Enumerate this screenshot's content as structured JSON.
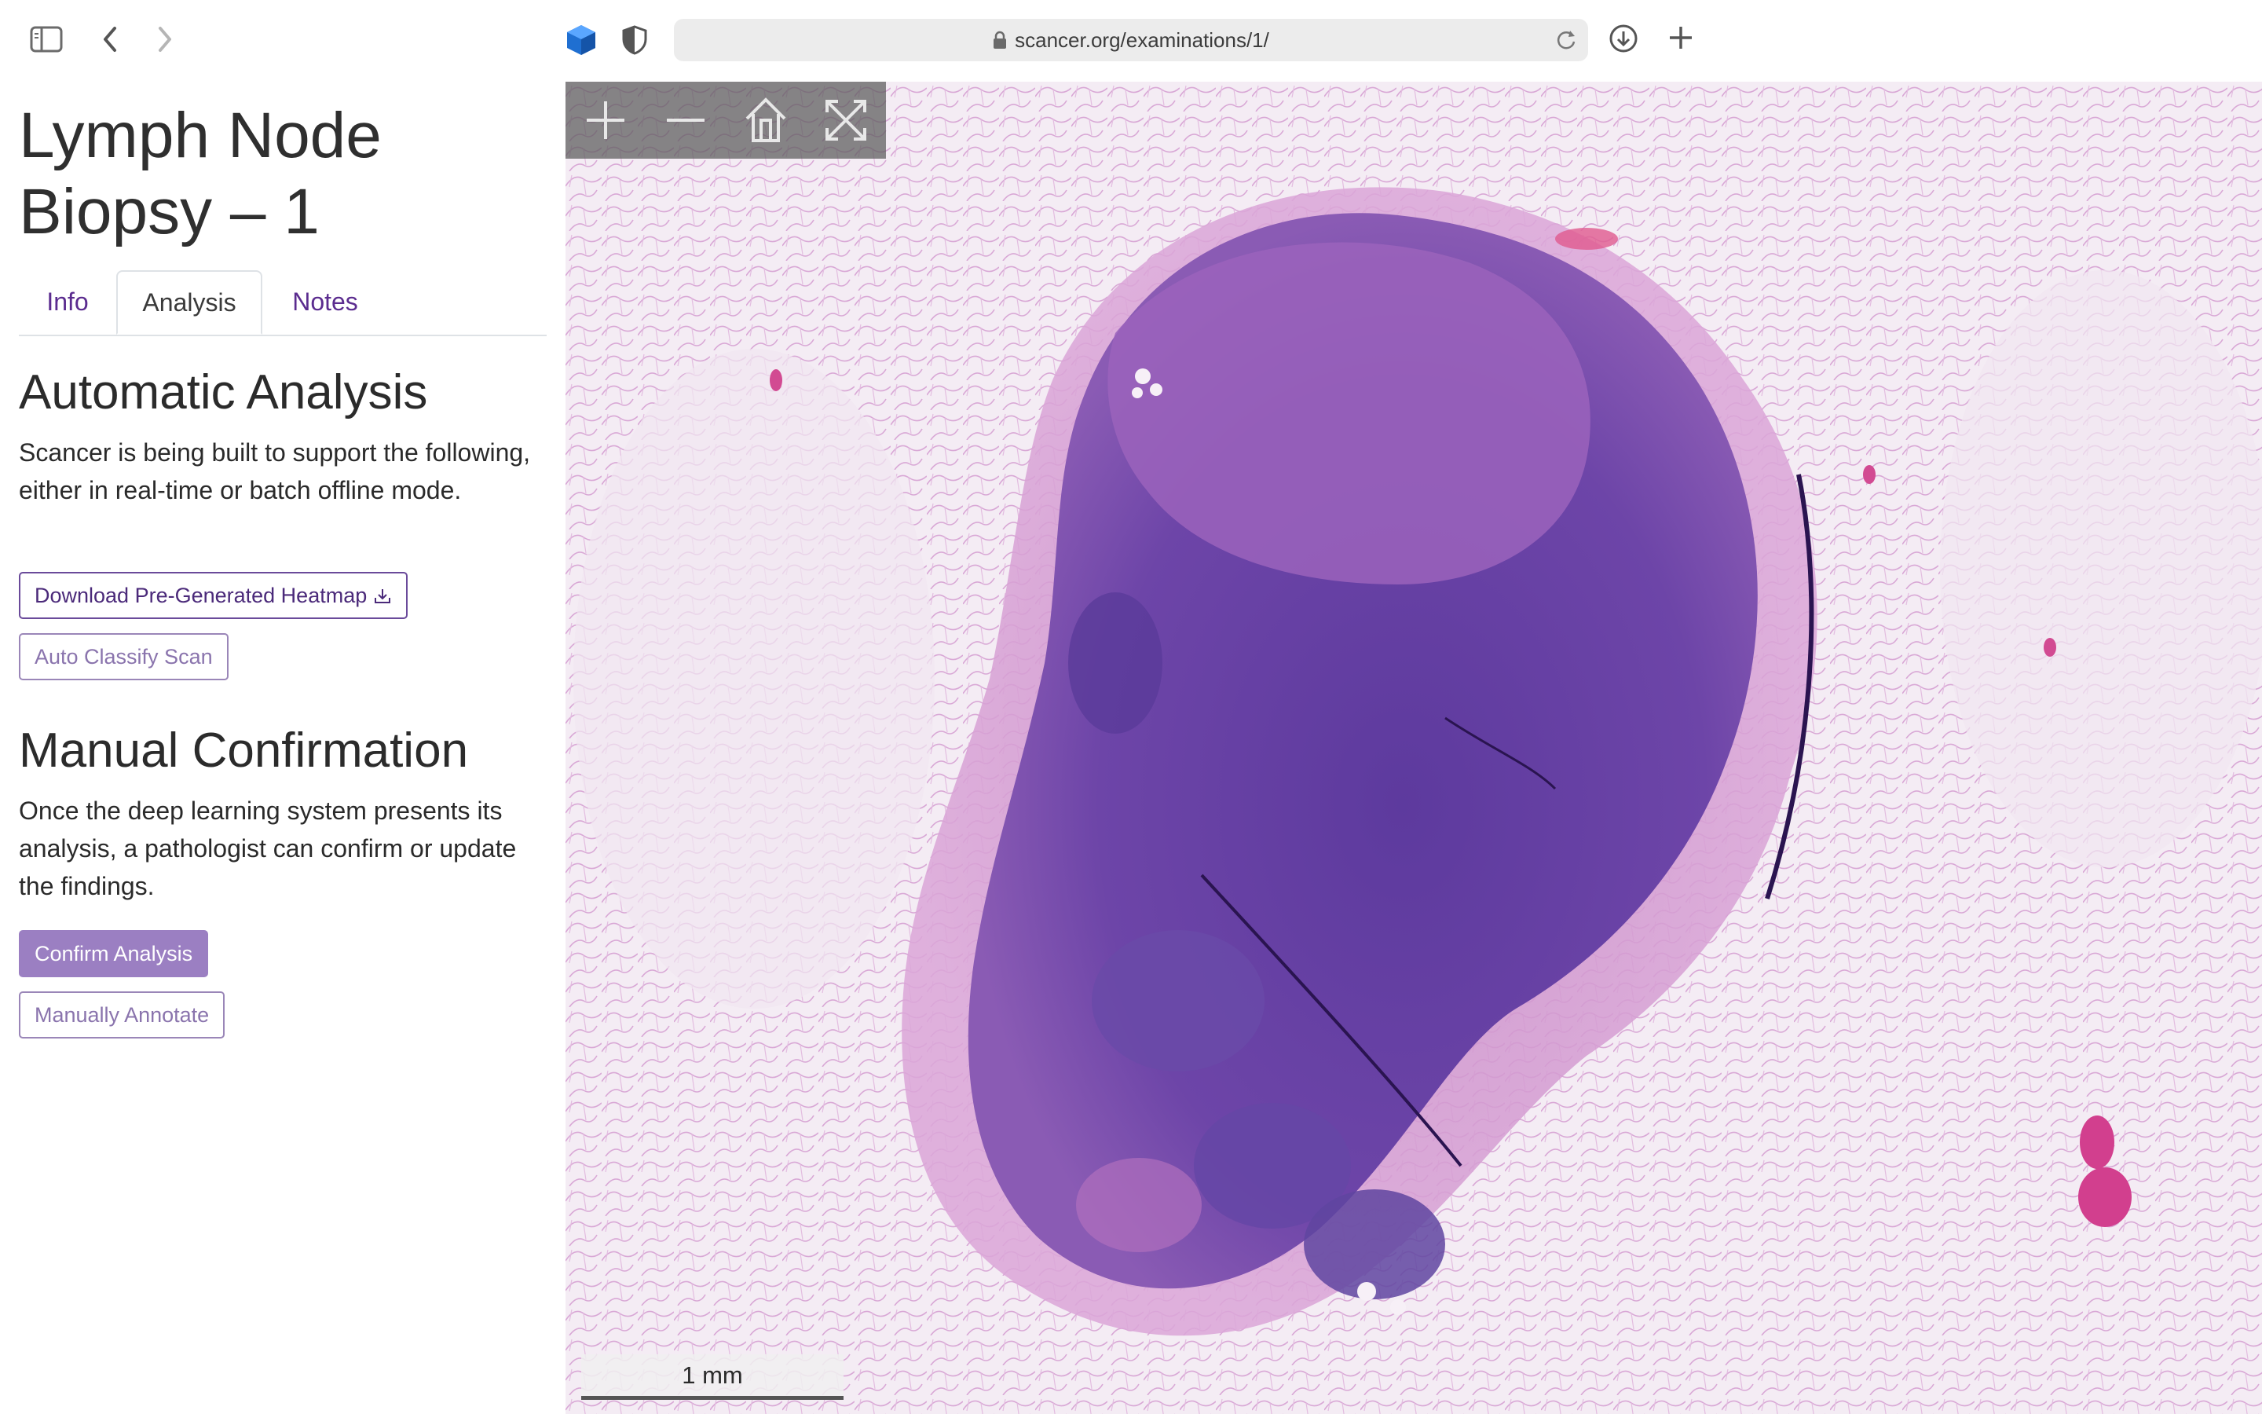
{
  "browser": {
    "url": "scancer.org/examinations/1/"
  },
  "sidebar": {
    "title": "Lymph Node Biopsy – 1",
    "tabs": [
      {
        "label": "Info",
        "active": false
      },
      {
        "label": "Analysis",
        "active": true
      },
      {
        "label": "Notes",
        "active": false
      }
    ],
    "automatic": {
      "heading": "Automatic Analysis",
      "text": "Scancer is being built to support the following, either in real-time or batch offline mode.",
      "download_button": "Download Pre-Generated Heatmap",
      "classify_button": "Auto Classify Scan"
    },
    "manual": {
      "heading": "Manual Confirmation",
      "text": "Once the deep learning system presents its analysis, a pathologist can confirm or update the findings.",
      "confirm_button": "Confirm Analysis",
      "annotate_button": "Manually Annotate"
    }
  },
  "viewer": {
    "scale_label": "1 mm",
    "nav": [
      "zoom-in-icon",
      "zoom-out-icon",
      "home-icon",
      "fullscreen-icon"
    ]
  },
  "colors": {
    "link": "#5b2c8f",
    "button_outline": "#6a4a9a",
    "button_filled": "#9b7fc2",
    "tissue_purple": "#6a3fa0",
    "tissue_pink": "#c77bc0"
  }
}
